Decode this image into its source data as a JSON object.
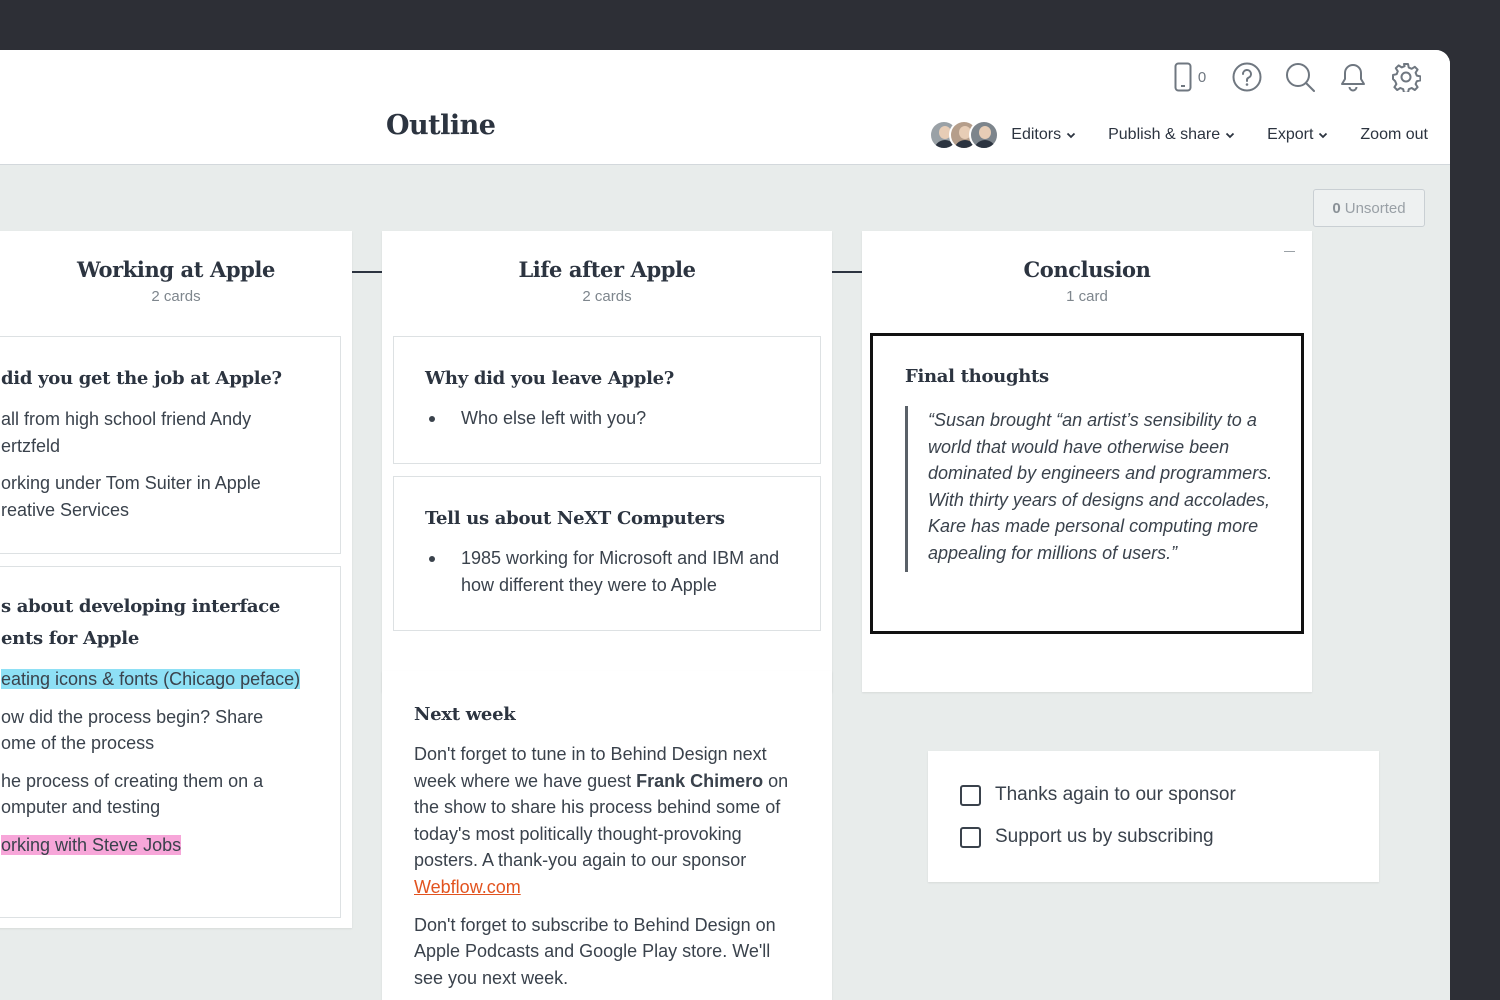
{
  "header": {
    "title": "Outline",
    "device_count": "0",
    "icons": [
      "phone-icon",
      "help-icon",
      "search-icon",
      "bell-icon",
      "gear-icon"
    ],
    "menu": {
      "editors": "Editors",
      "publish": "Publish & share",
      "export": "Export",
      "zoom": "Zoom out"
    }
  },
  "unsorted": {
    "count": "0",
    "label": "Unsorted"
  },
  "columns": [
    {
      "title": "Working at Apple",
      "count": "2 cards",
      "cards": [
        {
          "title": "did you get the job at Apple?",
          "lines": [
            "all from high school friend Andy ertzfeld",
            "orking under Tom Suiter in Apple reative Services"
          ]
        },
        {
          "title": "s about developing interface ents for Apple",
          "lines": [
            "eating icons & fonts (Chicago peface)",
            "ow did the process begin? Share ome of the process",
            "he process of creating them on a omputer and testing",
            "orking with Steve Jobs"
          ]
        }
      ]
    },
    {
      "title": "Life after Apple",
      "count": "2 cards",
      "cards": [
        {
          "title": "Why did you leave Apple?",
          "bullets": [
            "Who else left with you?"
          ]
        },
        {
          "title": "Tell us about NeXT Computers",
          "bullets": [
            "1985 working for Microsoft and IBM and how different they were to Apple"
          ]
        }
      ]
    },
    {
      "title": "Conclusion",
      "count": "1 card",
      "cards": [
        {
          "title": "Final thoughts",
          "quote": "“Susan brought “an artist’s sensibility to a world that would have otherwise been dominated by engineers and programmers. With thirty years of designs and accolades, Kare has made personal computing more appealing for millions of users.”"
        }
      ]
    }
  ],
  "next_week": {
    "title": "Next week",
    "p1_a": "Don't forget to tune in to Behind Design next week where we have guest ",
    "p1_bold": "Frank Chimero",
    "p1_b": " on the show to share his process behind some of today's most politically thought-provoking posters. A  thank-you again to our sponsor ",
    "p1_link": "Webflow.com",
    "p2": "Don't forget to subscribe to Behind Design on Apple Podcasts and Google Play store. We'll see you next week."
  },
  "checklist": {
    "items": [
      "Thanks again to our sponsor",
      "Support us by subscribing"
    ],
    "checked": [
      false,
      false
    ]
  },
  "colors": {
    "text": "#2c3440",
    "highlight_blue": "#8ee0f5",
    "highlight_pink": "#f7a6d9",
    "link": "#e2531f",
    "background": "#e8eceb",
    "frame": "#2d2f36"
  }
}
